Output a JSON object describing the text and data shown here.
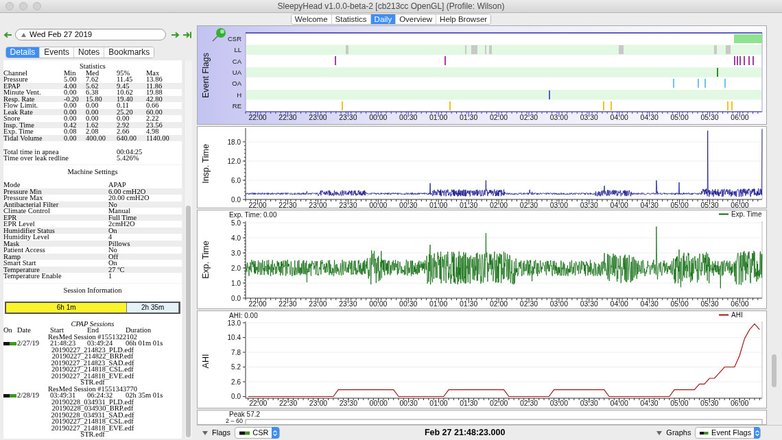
{
  "window": {
    "title": "SleepyHead v1.0.0-beta-2 [cb213cc OpenGL] (Profile: Wilson)"
  },
  "toolbar_tabs": [
    {
      "label": "Welcome",
      "selected": false
    },
    {
      "label": "Statistics",
      "selected": false
    },
    {
      "label": "Daily",
      "selected": true
    },
    {
      "label": "Overview",
      "selected": false
    },
    {
      "label": "Help Browser",
      "selected": false
    }
  ],
  "date_nav": {
    "date": "Wed Feb 27 2019"
  },
  "detail_tabs": [
    {
      "label": "Details",
      "selected": true
    },
    {
      "label": "Events",
      "selected": false
    },
    {
      "label": "Notes",
      "selected": false
    },
    {
      "label": "Bookmarks",
      "selected": false
    }
  ],
  "statistics": {
    "title": "Statistics",
    "columns": [
      "Channel",
      "Min",
      "Med",
      "95%",
      "Max"
    ],
    "rows": [
      [
        "Pressure",
        "5.00",
        "7.62",
        "11.45",
        "13.86"
      ],
      [
        "EPAP",
        "4.00",
        "5.62",
        "9.45",
        "11.86"
      ],
      [
        "Minute Vent.",
        "0.00",
        "6.38",
        "10.62",
        "19.88"
      ],
      [
        "Resp. Rate",
        "-0.20",
        "15.80",
        "19.40",
        "42.80"
      ],
      [
        "Flow Limit.",
        "0.00",
        "0.00",
        "0.11",
        "0.66"
      ],
      [
        "Leak Rate",
        "0.00",
        "0.00",
        "25.20",
        "60.00"
      ],
      [
        "Snore",
        "0.00",
        "0.00",
        "0.00",
        "2.22"
      ],
      [
        "Insp. Time",
        "0.42",
        "1.62",
        "2.92",
        "23.56"
      ],
      [
        "Exp. Time",
        "0.08",
        "2.08",
        "2.66",
        "4.98"
      ],
      [
        "Tidal Volume",
        "0.00",
        "400.00",
        "640.00",
        "1140.00"
      ]
    ],
    "summary": [
      {
        "label": "Total time in apnea",
        "value": "00:04:25"
      },
      {
        "label": "Time over leak redline",
        "value": "5.426%"
      }
    ]
  },
  "machine_settings": {
    "title": "Machine Settings",
    "rows": [
      {
        "label": "Mode",
        "value": "APAP"
      },
      {
        "label": "Pressure Min",
        "value": "6.00 cmH2O"
      },
      {
        "label": "Pressure Max",
        "value": "20.00 cmH2O"
      },
      {
        "label": "Antibacterial Filter",
        "value": "No"
      },
      {
        "label": "Climate Control",
        "value": "Manual"
      },
      {
        "label": "EPR",
        "value": "Full Time"
      },
      {
        "label": "EPR Level",
        "value": "2cmH2O"
      },
      {
        "label": "Humidifier Status",
        "value": "On"
      },
      {
        "label": "Humidity Level",
        "value": "4"
      },
      {
        "label": "Mask",
        "value": "Pillows"
      },
      {
        "label": "Patient Access",
        "value": "No"
      },
      {
        "label": "Ramp",
        "value": "Off"
      },
      {
        "label": "Smart Start",
        "value": "On"
      },
      {
        "label": "Temperature",
        "value": "27 ºC"
      },
      {
        "label": "Temperature Enable",
        "value": "1"
      }
    ]
  },
  "session_information": {
    "title": "Session Information",
    "segments": [
      {
        "label": "6h 1m",
        "level": 0.7,
        "color": "#fbf32c"
      },
      {
        "label": "2h 35m",
        "level": 0.3,
        "color": "#e3f1f9"
      }
    ]
  },
  "cpap_sessions": {
    "title": "CPAP Sessions",
    "columns": [
      "On",
      "Date",
      "Start",
      "End",
      "Duration"
    ],
    "sessions": [
      {
        "name": "ResMed Session #1551322102",
        "on": true,
        "date": "2/27/19",
        "start": "21:48:23",
        "end": "03:49:24",
        "duration": "06h 01m 01s",
        "files": [
          "20190227_214823_PLD.edf",
          "20190227_214822_BRP.edf",
          "20190227_214823_SAD.edf",
          "20190227_214818_CSL.edf",
          "20190227_214818_EVE.edf",
          "STR.edf"
        ]
      },
      {
        "name": "ResMed Session #1551343770",
        "on": true,
        "date": "2/28/19",
        "start": "03:49:31",
        "end": "06:24:32",
        "duration": "02h 35m 01s",
        "files": [
          "20190228_034931_PLD.edf",
          "20190228_034930_BRP.edf",
          "20190228_034931_SAD.edf",
          "20190227_214818_CSL.edf",
          "20190227_214818_EVE.edf",
          "STR.edf"
        ]
      }
    ]
  },
  "graphs": [
    {
      "kind": "flags",
      "title": "Event Flags",
      "rows": [
        {
          "label": "CSR",
          "color": "#8fe28f"
        },
        {
          "label": "LL",
          "color": "#c8c8c8"
        },
        {
          "label": "CA",
          "color": "#a43ca4"
        },
        {
          "label": "UA",
          "color": "#2e8b2e"
        },
        {
          "label": "OA",
          "color": "#6cc6f2"
        },
        {
          "label": "H",
          "color": "#4a5fd6"
        },
        {
          "label": "RE",
          "color": "#f2c21e"
        }
      ],
      "xticks": [
        "22:00",
        "22:30",
        "23:00",
        "23:30",
        "00:00",
        "00:30",
        "01:00",
        "01:30",
        "02:00",
        "02:30",
        "03:00",
        "03:30",
        "04:00",
        "04:30",
        "05:00",
        "05:30",
        "06:00"
      ]
    },
    {
      "kind": "waveform",
      "title": "Insp. Time",
      "color": "#0c0c8c",
      "yticks": [
        "18.0",
        "12.0",
        "6.0",
        "0.0"
      ],
      "xticks": [
        "22:00",
        "22:30",
        "23:00",
        "23:30",
        "00:00",
        "00:30",
        "01:00",
        "01:30",
        "02:00",
        "02:30",
        "03:00",
        "03:30",
        "04:00",
        "04:30",
        "05:00",
        "05:30",
        "06:00"
      ]
    },
    {
      "kind": "waveform",
      "title": "Exp. Time",
      "header": "Exp. Time: 0.00",
      "legend": "Exp. Time",
      "color": "#0a6a0a",
      "yticks": [
        "5.0",
        "4.0",
        "3.0",
        "2.0",
        "1.0",
        "0.0"
      ],
      "xticks": [
        "22:00",
        "22:30",
        "23:00",
        "23:30",
        "00:00",
        "00:30",
        "01:00",
        "01:30",
        "02:00",
        "02:30",
        "03:00",
        "03:30",
        "04:00",
        "04:30",
        "05:00",
        "05:30",
        "06:00"
      ]
    },
    {
      "kind": "line",
      "title": "AHI",
      "header": "AHI: 0.00",
      "chart_data": {
        "type": "line",
        "grid": true,
        "ylim": [
          0,
          13
        ],
        "categories": [
          null,
          null,
          "22:00",
          null,
          null,
          null,
          null,
          null,
          "22:30",
          null,
          null,
          null,
          null,
          null,
          "23:00",
          null,
          null,
          null,
          null,
          null,
          "23:30",
          null,
          null,
          null,
          null,
          null,
          "00:00",
          null,
          null,
          null,
          null,
          null,
          "00:30",
          null,
          null,
          null,
          null,
          null,
          "01:00",
          null,
          null,
          null,
          null,
          null,
          "01:30",
          null,
          null,
          null,
          null,
          null,
          "02:00",
          null,
          null,
          null,
          null,
          null,
          "02:30",
          null,
          null,
          null,
          null,
          null,
          "03:00",
          null,
          null,
          null,
          null,
          null,
          "03:30",
          null,
          null,
          null,
          null,
          null,
          "04:00",
          null,
          null,
          null,
          null,
          null,
          "04:30",
          null,
          null,
          null,
          null,
          null,
          "05:00",
          null,
          null,
          null,
          null,
          null,
          "05:30",
          null,
          null,
          null,
          null,
          null,
          "06:00",
          null,
          null,
          null,
          null
        ],
        "series": [
          {
            "name": "AHI",
            "color": "#a31515",
            "values": [
              0,
              0,
              0,
              0,
              0,
              0,
              0,
              0,
              0,
              0,
              0,
              0,
              0,
              0,
              0,
              0,
              0,
              0,
              1.2,
              1.2,
              1.2,
              1.2,
              1.2,
              1.2,
              1.2,
              1.2,
              1.2,
              1.2,
              1.2,
              1.2,
              0,
              0,
              0,
              0,
              0,
              0,
              0,
              0,
              0,
              0,
              1.2,
              1.2,
              1.2,
              1.2,
              1.2,
              1.2,
              1.2,
              1.2,
              1.2,
              1.2,
              1.2,
              1.2,
              0,
              0,
              0,
              0,
              0,
              0,
              0,
              0,
              0,
              1.2,
              1.2,
              1.2,
              1.2,
              1.2,
              1.2,
              1.2,
              1.2,
              1.2,
              1.2,
              1.2,
              0,
              0,
              0,
              0,
              0,
              0,
              0,
              0,
              0,
              0,
              0,
              0,
              0,
              1.2,
              1.2,
              1.2,
              1.2,
              1.2,
              2.2,
              2.2,
              3.2,
              3.2,
              4.2,
              5.2,
              5.2,
              5.2,
              7.2,
              10.2,
              11.8,
              12.8,
              11.8
            ]
          }
        ],
        "yticks": [
          {
            "value": 0,
            "label": "0.0"
          },
          {
            "value": 2.6,
            "label": "2.6"
          },
          {
            "value": 5.2,
            "label": "5.2"
          },
          {
            "value": 7.8,
            "label": "7.8"
          },
          {
            "value": 10.4,
            "label": "10.4"
          },
          {
            "value": 13,
            "label": "13.0"
          }
        ]
      }
    },
    {
      "kind": "peak",
      "header": "Peak 57.2",
      "axis_label": "2 – 60"
    }
  ],
  "bottom_bar": {
    "flags": {
      "label": "Flags",
      "selection": "CSR"
    },
    "timestamp": "Feb 27 21:48:23.000",
    "graphs": {
      "label": "Graphs",
      "selection": "Event Flags"
    }
  }
}
